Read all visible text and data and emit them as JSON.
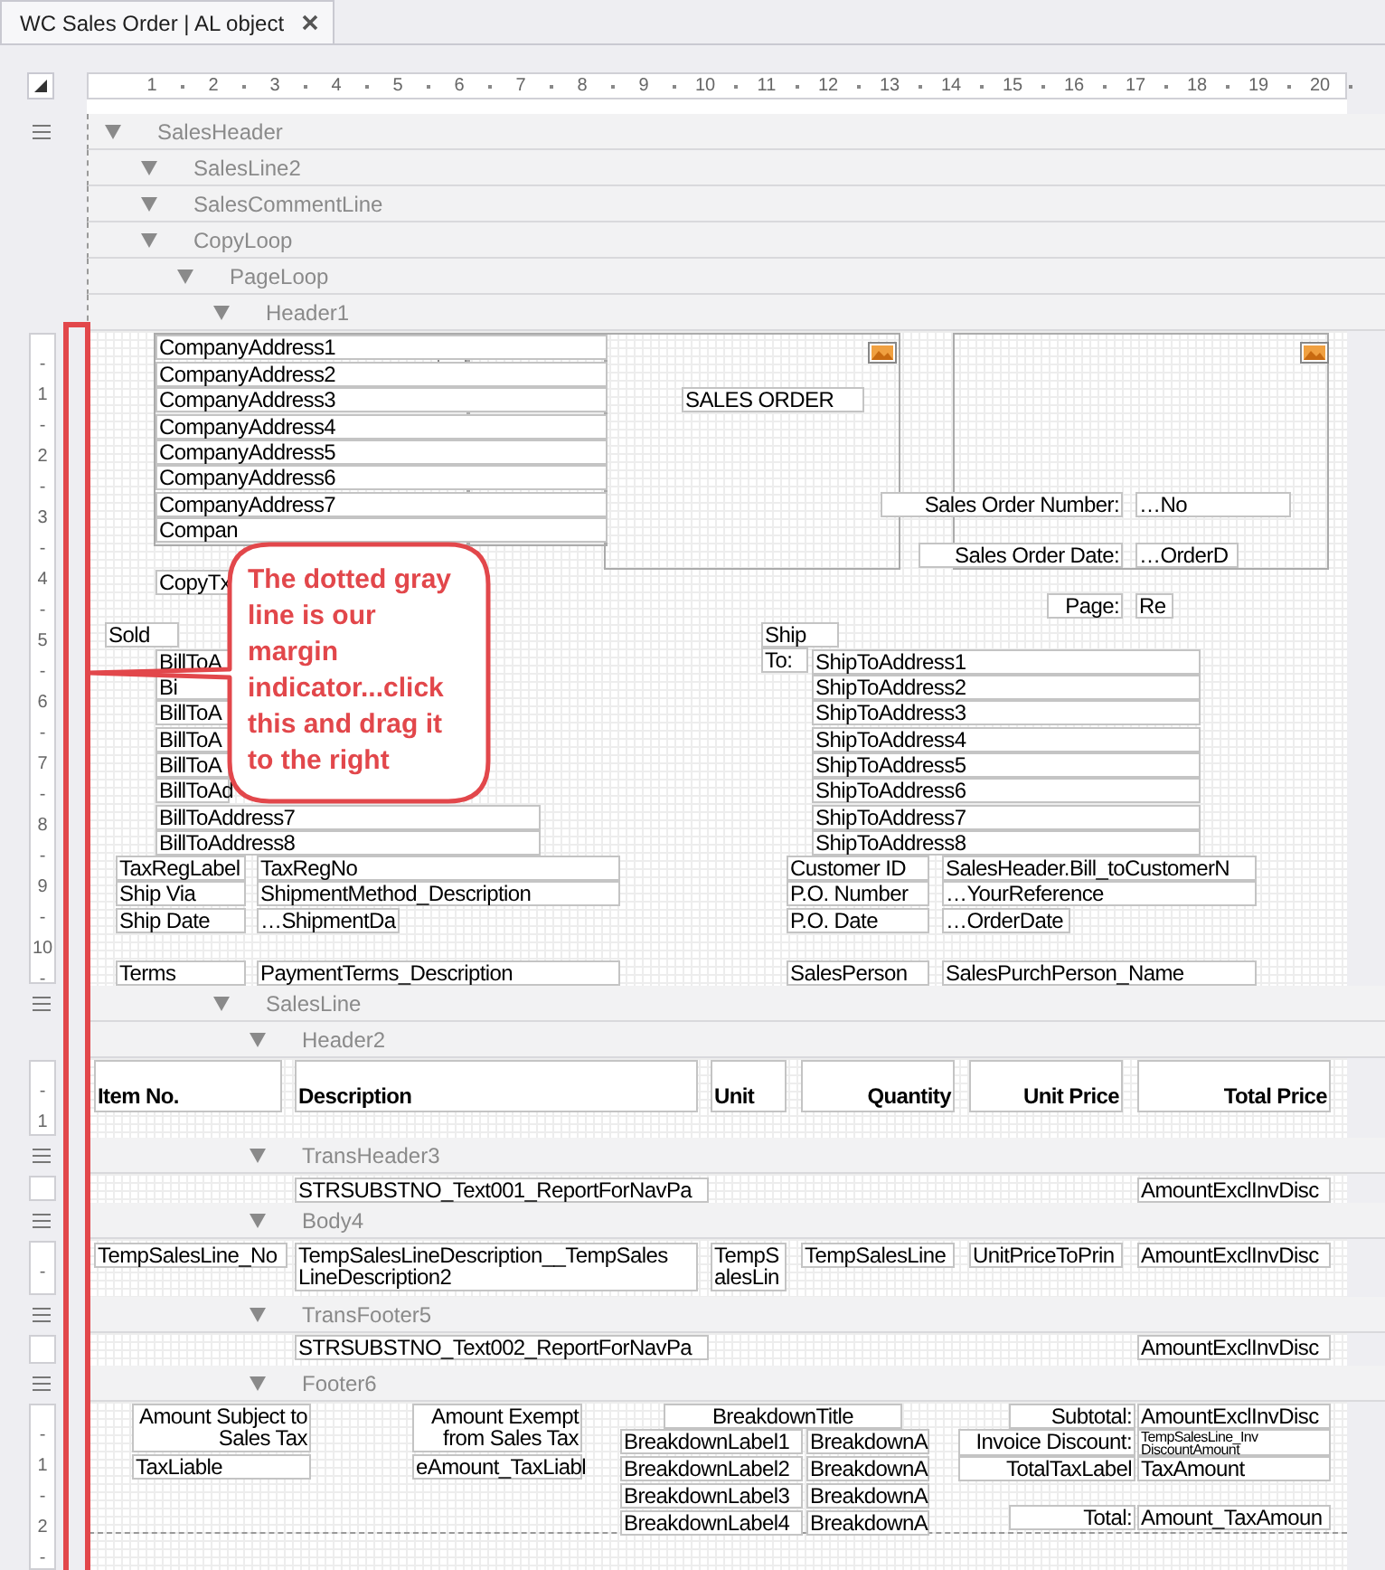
{
  "tab": {
    "title": "WC Sales Order | AL object"
  },
  "ruler": {
    "numbers": [
      "1",
      "2",
      "3",
      "4",
      "5",
      "6",
      "7",
      "8",
      "9",
      "10",
      "11",
      "12",
      "13",
      "14",
      "15",
      "16",
      "17",
      "18",
      "19",
      "20"
    ]
  },
  "report": {
    "bands": [
      {
        "label": "SalesHeader",
        "expanded": true,
        "handle": true,
        "children": [
          {
            "label": "SalesLine2",
            "expanded": true,
            "handle": false
          },
          {
            "label": "SalesCommentLine",
            "expanded": true,
            "handle": false
          },
          {
            "label": "CopyLoop",
            "expanded": true,
            "handle": false,
            "children": [
              {
                "label": "PageLoop",
                "expanded": true,
                "handle": false,
                "children": [
                  {
                    "label": "Header1",
                    "expanded": true,
                    "handle": false,
                    "section": {
                      "kind": "header1",
                      "ruler_marks": [
                        "-",
                        "1",
                        "-",
                        "2",
                        "-",
                        "3",
                        "-",
                        "4",
                        "-",
                        "5",
                        "-",
                        "6",
                        "-",
                        "7",
                        "-",
                        "8",
                        "-",
                        "9",
                        "-",
                        "10",
                        "-"
                      ],
                      "fields": [
                        {
                          "text": "CompanyAddress1"
                        },
                        {
                          "text": "CompanyAddress2"
                        },
                        {
                          "text": "CompanyAddress3"
                        },
                        {
                          "text": "SALES ORDER"
                        },
                        {
                          "text": "CompanyAddress4"
                        },
                        {
                          "text": "CompanyAddress5"
                        },
                        {
                          "text": "CompanyAddress6"
                        },
                        {
                          "text": "CompanyAddress7"
                        },
                        {
                          "text": "Sales Order Number:"
                        },
                        {
                          "text": "…No"
                        },
                        {
                          "text": "Compan"
                        },
                        {
                          "text": "Sales Order Date:"
                        },
                        {
                          "text": "…OrderD"
                        },
                        {
                          "text": "CopyTx"
                        },
                        {
                          "text": "Page:"
                        },
                        {
                          "text": "Re"
                        },
                        {
                          "text": "Sold"
                        },
                        {
                          "text": "Ship"
                        },
                        {
                          "text": "BillToA"
                        },
                        {
                          "text": "To:"
                        },
                        {
                          "text": "ShipToAddress1"
                        },
                        {
                          "text": "Bi"
                        },
                        {
                          "text": "ShipToAddress2"
                        },
                        {
                          "text": "BillToA"
                        },
                        {
                          "text": "ShipToAddress3"
                        },
                        {
                          "text": "BillToA"
                        },
                        {
                          "text": "ShipToAddress4"
                        },
                        {
                          "text": "BillToA"
                        },
                        {
                          "text": "ShipToAddress5"
                        },
                        {
                          "text": "BillToAd"
                        },
                        {
                          "text": "ShipToAddress6"
                        },
                        {
                          "text": "BillToAddress7"
                        },
                        {
                          "text": "ShipToAddress7"
                        },
                        {
                          "text": "BillToAddress8"
                        },
                        {
                          "text": "ShipToAddress8"
                        },
                        {
                          "text": "TaxRegLabel"
                        },
                        {
                          "text": "TaxRegNo"
                        },
                        {
                          "text": "Customer ID"
                        },
                        {
                          "text": "SalesHeader.Bill_toCustomerN"
                        },
                        {
                          "text": "Ship Via"
                        },
                        {
                          "text": "ShipmentMethod_Description"
                        },
                        {
                          "text": "P.O. Number"
                        },
                        {
                          "text": "…YourReference"
                        },
                        {
                          "text": "Ship Date"
                        },
                        {
                          "text": "…ShipmentDa"
                        },
                        {
                          "text": "P.O. Date"
                        },
                        {
                          "text": "…OrderDate"
                        },
                        {
                          "text": "Terms"
                        },
                        {
                          "text": "PaymentTerms_Description"
                        },
                        {
                          "text": "SalesPerson"
                        },
                        {
                          "text": "SalesPurchPerson_Name"
                        }
                      ]
                    }
                  },
                  {
                    "label": "SalesLine",
                    "expanded": true,
                    "handle": true,
                    "children": [
                      {
                        "label": "Header2",
                        "expanded": true,
                        "handle": false,
                        "section": {
                          "kind": "column-headers",
                          "ruler_marks": [
                            "-",
                            "1"
                          ],
                          "fields": [
                            {
                              "text": "Item No."
                            },
                            {
                              "text": "Description"
                            },
                            {
                              "text": "Unit"
                            },
                            {
                              "text": "Quantity"
                            },
                            {
                              "text": "Unit Price"
                            },
                            {
                              "text": "Total Price"
                            }
                          ]
                        }
                      },
                      {
                        "label": "TransHeader3",
                        "expanded": true,
                        "handle": true,
                        "section": {
                          "kind": "trans-header",
                          "fields": [
                            {
                              "text": "STRSUBSTNO_Text001_ReportForNavPa"
                            },
                            {
                              "text": "AmountExclInvDisc"
                            }
                          ]
                        }
                      },
                      {
                        "label": "Body4",
                        "expanded": true,
                        "handle": true,
                        "section": {
                          "kind": "body",
                          "ruler_marks": [
                            "-"
                          ],
                          "fields": [
                            {
                              "text": "TempSalesLine_No"
                            },
                            {
                              "text": "TempSalesLineDescription__TempSales\nLineDescription2"
                            },
                            {
                              "text": "TempS\nalesLin"
                            },
                            {
                              "text": "TempSalesLine"
                            },
                            {
                              "text": "UnitPriceToPrin"
                            },
                            {
                              "text": "AmountExclInvDisc"
                            }
                          ]
                        }
                      },
                      {
                        "label": "TransFooter5",
                        "expanded": true,
                        "handle": true,
                        "section": {
                          "kind": "trans-footer",
                          "fields": [
                            {
                              "text": "STRSUBSTNO_Text002_ReportForNavPa"
                            },
                            {
                              "text": "AmountExclInvDisc"
                            }
                          ]
                        }
                      },
                      {
                        "label": "Footer6",
                        "expanded": true,
                        "handle": true,
                        "section": {
                          "kind": "footer",
                          "ruler_marks": [
                            "-",
                            "1",
                            "-",
                            "2",
                            "-"
                          ],
                          "fields": [
                            {
                              "text": "Amount Subject to\nSales Tax"
                            },
                            {
                              "text": "Amount Exempt\nfrom Sales Tax"
                            },
                            {
                              "text": "BreakdownTitle"
                            },
                            {
                              "text": "Subtotal:"
                            },
                            {
                              "text": "AmountExclInvDisc"
                            },
                            {
                              "text": "BreakdownLabel1"
                            },
                            {
                              "text": "BreakdownA"
                            },
                            {
                              "text": "Invoice Discount:"
                            },
                            {
                              "text": "TempSalesLine_Inv\nDiscountAmount"
                            },
                            {
                              "text": "TaxLiable"
                            },
                            {
                              "text": "eAmount_TaxLiabl"
                            },
                            {
                              "text": "BreakdownLabel2"
                            },
                            {
                              "text": "BreakdownA"
                            },
                            {
                              "text": "TotalTaxLabel"
                            },
                            {
                              "text": "TaxAmount"
                            },
                            {
                              "text": "BreakdownLabel3"
                            },
                            {
                              "text": "BreakdownA"
                            },
                            {
                              "text": "BreakdownLabel4"
                            },
                            {
                              "text": "BreakdownA"
                            },
                            {
                              "text": "Total:"
                            },
                            {
                              "text": "Amount_TaxAmoun"
                            }
                          ]
                        }
                      }
                    ]
                  }
                ]
              }
            ]
          }
        ]
      }
    ]
  },
  "callout": {
    "text": "The dotted gray line is our margin indicator...click this and drag it to the right"
  }
}
